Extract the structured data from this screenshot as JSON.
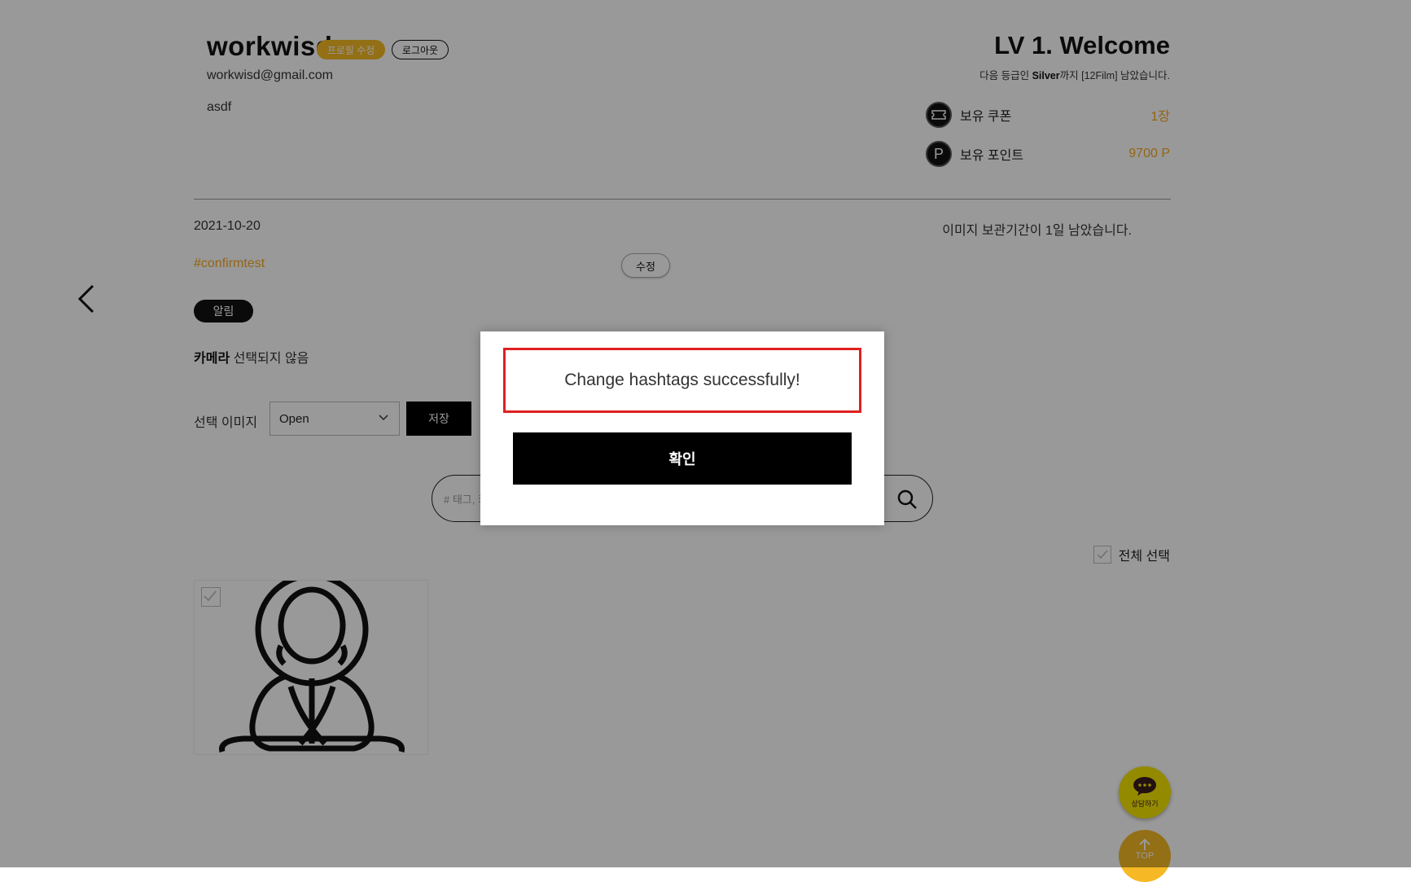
{
  "profile": {
    "username": "workwisd",
    "edit_profile_label": "프로필 수정",
    "logout_label": "로그아웃",
    "email": "workwisd@gmail.com",
    "bio": "asdf"
  },
  "level": {
    "title": "LV 1. Welcome",
    "next_prefix": "다음 등급인 ",
    "next_grade": "Silver",
    "next_suffix": "까지 [12Film] 남았습니다."
  },
  "stats": {
    "coupon_label": "보유 쿠폰",
    "coupon_value": "1장",
    "points_icon": "P",
    "points_label": "보유 포인트",
    "points_value": "9700 P"
  },
  "detail": {
    "date": "2021-10-20",
    "retention_notice": "이미지 보관기간이 1일 남았습니다.",
    "hashtag": "#confirmtest",
    "edit_label": "수정",
    "notify_label": "알림",
    "camera_label": "카메라",
    "camera_value": " 선택되지 않음",
    "select_image_label": "선택 이미지",
    "select_value": "Open",
    "save_label": "저장"
  },
  "search": {
    "placeholder": "# 태그, 키워드"
  },
  "gallery": {
    "select_all_label": "전체 선택"
  },
  "floating": {
    "chat_label": "상담하기",
    "top_label": "TOP"
  },
  "modal": {
    "message": "Change hashtags successfully!",
    "confirm_label": "확인"
  },
  "colors": {
    "accent": "#f6b925",
    "highlight_border": "#e02020"
  }
}
